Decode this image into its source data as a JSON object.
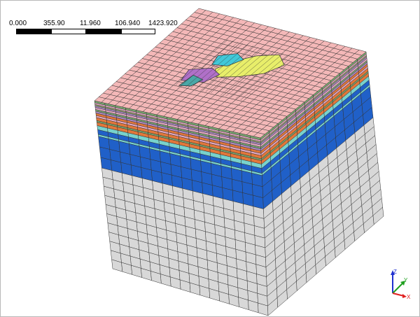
{
  "scale_bar": {
    "labels": [
      "0.000",
      "355.90",
      "11.960",
      "106.940",
      "1423.920"
    ],
    "segment_colors": [
      "#000000",
      "#ffffff",
      "#000000",
      "#ffffff"
    ]
  },
  "model": {
    "top_color": "#f4b8b8",
    "layer_colors": {
      "gray": "#d8d8d8",
      "blue": "#2060c8",
      "cyan": "#78d2cc",
      "orange": "#e2773a",
      "purple": "#a889c0",
      "green": "#7aa670",
      "olive": "#9aa870",
      "pink": "#e0a7c0"
    },
    "overlay_colors": {
      "yellow": "#e8ee6a",
      "violet": "#b070c8",
      "cyan": "#40c8d8",
      "teal": "#4aa7a7"
    },
    "mesh_line_color": "#333333"
  },
  "triad": {
    "x_label": "X",
    "y_label": "Y",
    "z_label": "Z",
    "x_color": "#e02020",
    "y_color": "#20a020",
    "z_color": "#2030d0"
  }
}
